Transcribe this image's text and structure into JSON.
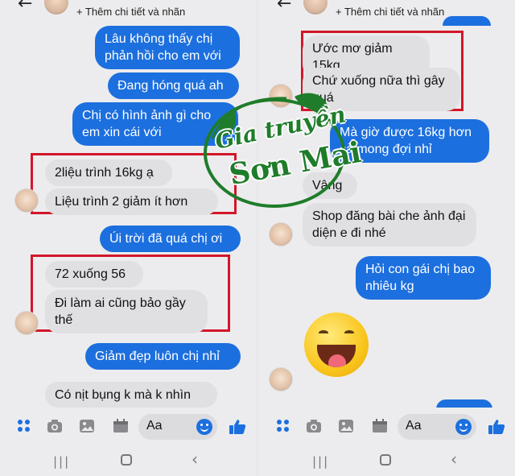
{
  "header": {
    "subtitle": "+ Thêm chi tiết và nhãn"
  },
  "left": {
    "messages": [
      {
        "text": "Lâu không thấy chị phản hồi cho em với",
        "dir": "out"
      },
      {
        "text": "Đang hóng quá ah",
        "dir": "out"
      },
      {
        "text": "Chị có hình ảnh gì cho em xin cái với",
        "dir": "out"
      },
      {
        "text": "2liệu trình 16kg ạ",
        "dir": "in"
      },
      {
        "text": "Liệu trình 2 giảm ít hơn",
        "dir": "in"
      },
      {
        "text": "Úi trời đã quá chị ơi",
        "dir": "out"
      },
      {
        "text": "72 xuống 56",
        "dir": "in"
      },
      {
        "text": "Đi làm ai cũng bảo gầy thế",
        "dir": "in"
      },
      {
        "text": "Giảm đẹp luôn chị nhỉ",
        "dir": "out"
      },
      {
        "text": "Có nịt bụng k mà k nhìn",
        "dir": "in"
      }
    ]
  },
  "right": {
    "messages": [
      {
        "text": "Ước mơ giảm 15kg",
        "dir": "in"
      },
      {
        "text": "Chứ xuống nữa thì gây quá",
        "dir": "in"
      },
      {
        "text": "Mà giờ được 16kg hơn cả mong đợi nhỉ",
        "dir": "out"
      },
      {
        "text": "Vâng",
        "dir": "in"
      },
      {
        "text": "Shop đăng bài che ảnh đại diện e đi nhé",
        "dir": "in"
      },
      {
        "text": "Hỏi con gái chị bao nhiêu kg",
        "dir": "out"
      }
    ],
    "sticker": "laughing-tongue-emoji"
  },
  "composer": {
    "placeholder": "Aa"
  },
  "icons": [
    "back-arrow-icon",
    "apps-icon",
    "camera-icon",
    "image-icon",
    "calendar-icon",
    "emoji-icon",
    "like-icon",
    "recent-apps-icon",
    "home-icon",
    "nav-back-icon"
  ],
  "watermark": {
    "line1": "Gia truyền",
    "line2": "Sơn Mai"
  },
  "colors": {
    "outgoing": "#1c6fde",
    "incoming": "#e0e0e3",
    "highlight_box": "#d3162a",
    "watermark": "#1f7c2a"
  }
}
